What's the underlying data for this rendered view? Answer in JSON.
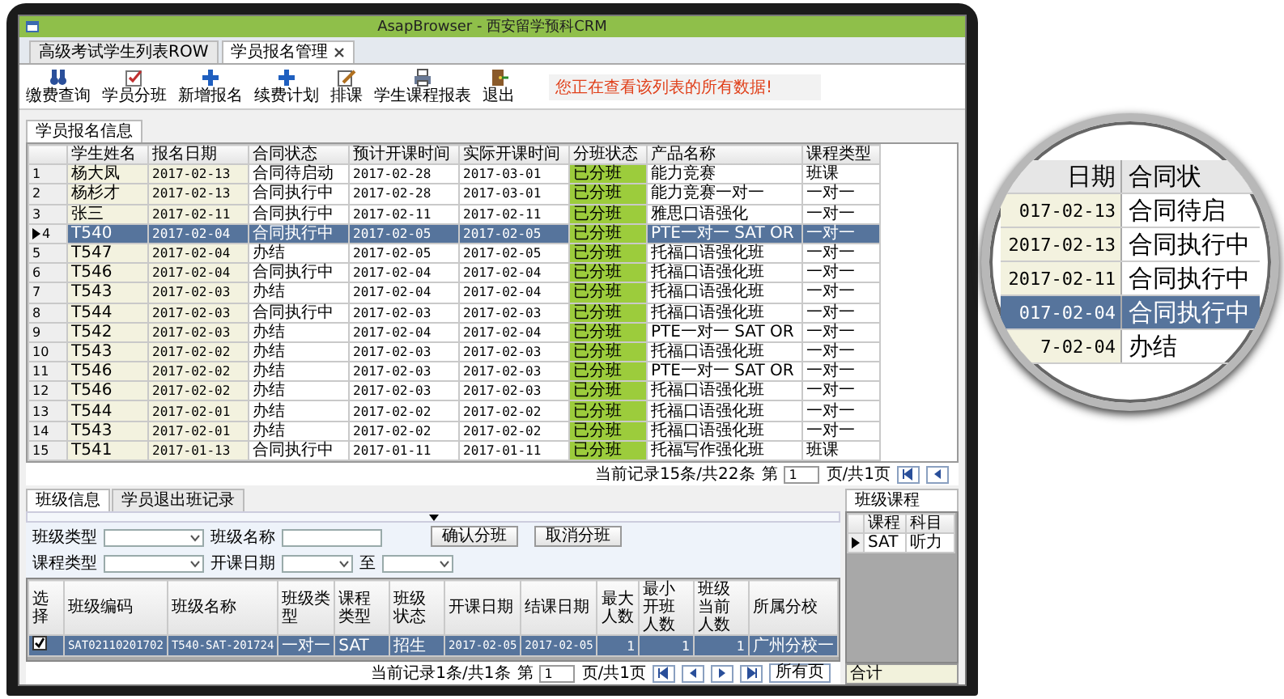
{
  "window": {
    "title": "AsapBrowser - 西安留学预科CRM"
  },
  "tabs": [
    {
      "label": "高级考试学生列表ROW",
      "selected": false,
      "closable": false
    },
    {
      "label": "学员报名管理",
      "selected": true,
      "closable": true
    }
  ],
  "toolbar": [
    {
      "label": "缴费查询",
      "kind": "binoculars"
    },
    {
      "label": "学员分班",
      "kind": "check"
    },
    {
      "label": "新增报名",
      "kind": "plus"
    },
    {
      "label": "续费计划",
      "kind": "plus"
    },
    {
      "label": "排课",
      "kind": "edit"
    },
    {
      "label": "学生课程报表",
      "kind": "printer"
    },
    {
      "label": "退出",
      "kind": "exit"
    }
  ],
  "notice": "您正在查看该列表的所有数据!",
  "list_panel": {
    "tab": "学员报名信息",
    "columns": [
      {
        "label": "学生姓名",
        "kind": "text"
      },
      {
        "label": "报名日期",
        "kind": "date"
      },
      {
        "label": "合同状态",
        "kind": "text"
      },
      {
        "label": "预计开课时间",
        "kind": "date"
      },
      {
        "label": "实际开课时间",
        "kind": "date"
      },
      {
        "label": "分班状态",
        "kind": "tag"
      },
      {
        "label": "产品名称",
        "kind": "text"
      },
      {
        "label": "课程类型",
        "kind": "text"
      }
    ],
    "rows": [
      {
        "no": "1",
        "selected": false,
        "cells": [
          "杨大凤",
          "2017-02-13",
          "合同待启动",
          "2017-02-28",
          "2017-03-01",
          "已分班",
          "能力竞赛",
          "班课"
        ]
      },
      {
        "no": "2",
        "selected": false,
        "cells": [
          "杨杉才",
          "2017-02-13",
          "合同执行中",
          "2017-02-28",
          "2017-03-01",
          "已分班",
          "能力竞赛一对一",
          "一对一"
        ]
      },
      {
        "no": "3",
        "selected": false,
        "cells": [
          "张三",
          "2017-02-11",
          "合同执行中",
          "2017-02-11",
          "2017-02-11",
          "已分班",
          "雅思口语强化",
          "一对一"
        ]
      },
      {
        "no": "4",
        "selected": true,
        "cells": [
          "T540",
          "2017-02-04",
          "合同执行中",
          "2017-02-05",
          "2017-02-05",
          "已分班",
          "PTE一对一 SAT OR",
          "一对一"
        ]
      },
      {
        "no": "5",
        "selected": false,
        "cells": [
          "T547",
          "2017-02-04",
          "办结",
          "2017-02-05",
          "2017-02-05",
          "已分班",
          "托福口语强化班",
          "一对一"
        ]
      },
      {
        "no": "6",
        "selected": false,
        "cells": [
          "T546",
          "2017-02-04",
          "合同执行中",
          "2017-02-04",
          "2017-02-04",
          "已分班",
          "托福口语强化班",
          "一对一"
        ]
      },
      {
        "no": "7",
        "selected": false,
        "cells": [
          "T543",
          "2017-02-03",
          "办结",
          "2017-02-04",
          "2017-02-04",
          "已分班",
          "托福口语强化班",
          "一对一"
        ]
      },
      {
        "no": "8",
        "selected": false,
        "cells": [
          "T544",
          "2017-02-03",
          "合同执行中",
          "2017-02-03",
          "2017-02-03",
          "已分班",
          "托福口语强化班",
          "一对一"
        ]
      },
      {
        "no": "9",
        "selected": false,
        "cells": [
          "T542",
          "2017-02-03",
          "办结",
          "2017-02-04",
          "2017-02-04",
          "已分班",
          "PTE一对一 SAT OR",
          "一对一"
        ]
      },
      {
        "no": "10",
        "selected": false,
        "cells": [
          "T543",
          "2017-02-02",
          "办结",
          "2017-02-03",
          "2017-02-03",
          "已分班",
          "托福口语强化班",
          "一对一"
        ]
      },
      {
        "no": "11",
        "selected": false,
        "cells": [
          "T546",
          "2017-02-02",
          "办结",
          "2017-02-03",
          "2017-02-03",
          "已分班",
          "PTE一对一 SAT OR",
          "一对一"
        ]
      },
      {
        "no": "12",
        "selected": false,
        "cells": [
          "T546",
          "2017-02-02",
          "办结",
          "2017-02-03",
          "2017-02-03",
          "已分班",
          "托福口语强化班",
          "一对一"
        ]
      },
      {
        "no": "13",
        "selected": false,
        "cells": [
          "T544",
          "2017-02-01",
          "办结",
          "2017-02-02",
          "2017-02-02",
          "已分班",
          "托福口语强化班",
          "一对一"
        ]
      },
      {
        "no": "14",
        "selected": false,
        "cells": [
          "T543",
          "2017-02-01",
          "办结",
          "2017-02-02",
          "2017-02-02",
          "已分班",
          "托福口语强化班",
          "一对一"
        ]
      },
      {
        "no": "15",
        "selected": false,
        "cells": [
          "T541",
          "2017-01-13",
          "合同执行中",
          "2017-01-11",
          "2017-01-11",
          "已分班",
          "托福写作强化班",
          "班课"
        ]
      }
    ],
    "pager": {
      "summary": "当前记录15条/共22条",
      "page_label": "第",
      "page": "1",
      "total": "页/共1页"
    }
  },
  "bottom_tabs": [
    {
      "label": "班级信息",
      "selected": true
    },
    {
      "label": "学员退出班记录",
      "selected": false
    }
  ],
  "filters": [
    {
      "label": "班级类型",
      "kind": "select"
    },
    {
      "label": "班级名称",
      "kind": "input"
    },
    {
      "label": "课程类型",
      "kind": "select"
    },
    {
      "label": "开课日期",
      "kind": "date"
    },
    {
      "label": "至",
      "kind": "date"
    }
  ],
  "actions": [
    "确认分班",
    "取消分班"
  ],
  "class_table": {
    "columns": [
      {
        "label": "选择",
        "kind": "check"
      },
      {
        "label": "班级编码",
        "kind": "date"
      },
      {
        "label": "班级名称",
        "kind": "date"
      },
      {
        "label": "班级类型",
        "kind": "text"
      },
      {
        "label": "课程类型",
        "kind": "text"
      },
      {
        "label": "班级状态",
        "kind": "text"
      },
      {
        "label": "开课日期",
        "kind": "date"
      },
      {
        "label": "结课日期",
        "kind": "date"
      },
      {
        "label": "最大人数",
        "kind": "num"
      },
      {
        "label": "最小开班人数",
        "kind": "num"
      },
      {
        "label": "班级当前人数",
        "kind": "num"
      },
      {
        "label": "所属分校",
        "kind": "text"
      }
    ],
    "rows": [
      {
        "selected": true,
        "checked": true,
        "cells": [
          "",
          "SAT02110201702",
          "T540-SAT-201724",
          "一对一",
          "SAT",
          "招生",
          "2017-02-05",
          "2017-02-05",
          "1",
          "1",
          "1",
          "广州分校一"
        ]
      }
    ],
    "pager": {
      "summary": "当前记录1条/共1条",
      "page_label": "第",
      "page": "1",
      "total": "页/共1页",
      "all_pages": "所有页"
    }
  },
  "course_panel": {
    "tab": "班级课程",
    "columns": [
      "课程",
      "科目"
    ],
    "rows": [
      {
        "selected": true,
        "cells": [
          "SAT",
          "听力"
        ]
      }
    ],
    "footer": "合计"
  },
  "lens": {
    "columns": [
      "日期",
      "合同状"
    ],
    "rows": [
      {
        "selected": false,
        "cells": [
          "017-02-13",
          "合同待启"
        ]
      },
      {
        "selected": false,
        "cells": [
          "2017-02-13",
          "合同执行中"
        ]
      },
      {
        "selected": false,
        "cells": [
          "2017-02-11",
          "合同执行中"
        ]
      },
      {
        "selected": true,
        "cells": [
          "017-02-04",
          "合同执行中"
        ]
      },
      {
        "selected": false,
        "cells": [
          "7-02-04",
          "办结"
        ]
      }
    ]
  }
}
